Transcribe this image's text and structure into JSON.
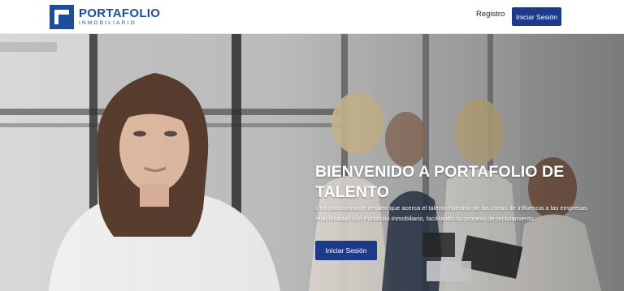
{
  "header": {
    "logo": {
      "title": "PORTAFOLIO",
      "subtitle": "INMOBILIARIO",
      "icon": "logo-icon"
    },
    "nav": {
      "register_label": "Registro",
      "login_label": "Iniciar Sesión"
    }
  },
  "hero": {
    "title": "BIENVENIDO A PORTAFOLIO DE TALENTO",
    "description": "Una plataforma de empleo que acerca el talento humano de las zonas de influencia a las empresas relacionadas con Portafolio Inmobiliario, facilitando su proceso de reclutamiento.",
    "cta_label": "Iniciar Sesión",
    "image": "office-team-photo"
  },
  "colors": {
    "brand_blue": "#1d4c9b",
    "button_blue": "#1d3a8a",
    "text_white": "#ffffff"
  }
}
